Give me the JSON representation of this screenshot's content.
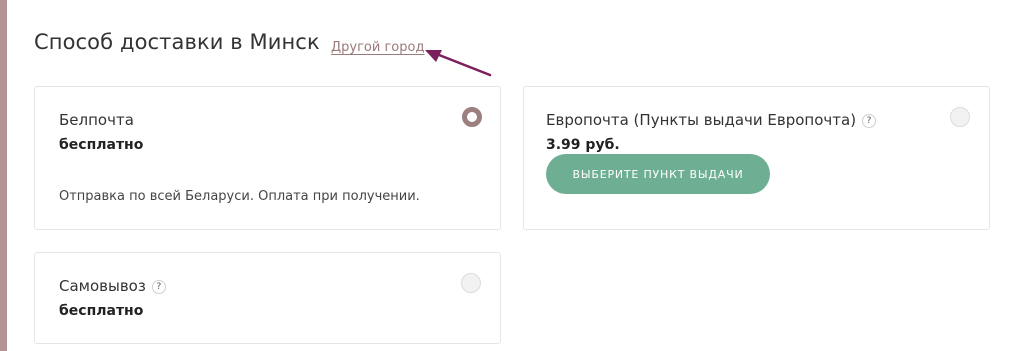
{
  "header": {
    "title": "Способ доставки в Минск",
    "other_city_link": "Другой город"
  },
  "delivery_options": [
    {
      "name": "Белпочта",
      "price": "бесплатно",
      "description": "Отправка по всей Беларуси. Оплата при получении.",
      "selected": true
    },
    {
      "name": "Европочта (Пункты выдачи Европочта)",
      "help": "?",
      "price": "3.99 руб.",
      "button_label": "ВЫБЕРИТЕ ПУНКТ ВЫДАЧИ",
      "selected": false
    },
    {
      "name": "Самовывоз",
      "help": "?",
      "price": "бесплатно",
      "selected": false
    }
  ],
  "colors": {
    "accent": "#9c8080",
    "button": "#6eae92",
    "arrow": "#7a1f5c",
    "left_bar": "#b39393"
  }
}
